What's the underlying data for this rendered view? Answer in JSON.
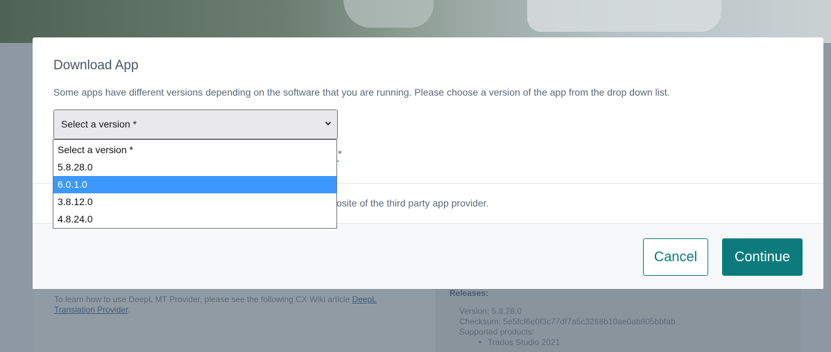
{
  "background": {
    "article_text": "To learn how to use DeepL MT Provider, please see the following CX Wiki article",
    "article_link": "DeepL Translation Provider",
    "article_link_line1": "DeepL",
    "article_link_line2": "Translation Provider",
    "article_end": ".",
    "releases_title": "Releases:",
    "version": "Version: 5.8.28.0",
    "checksum": "Checksum: 5e5fcf6e0f3c77df7a5c3268b10ae0ab905bbfab",
    "supported_products": "Supported products:",
    "product_bullet": "•",
    "product": "Trados Studio 2021"
  },
  "modal": {
    "title": "Download App",
    "description": "Some apps have different versions depending on the software that you are running. Please choose a version of the app from the drop down list.",
    "agree_asterisk": "*",
    "third_party_text": "osite of the third party app provider.",
    "cancel_label": "Cancel",
    "continue_label": "Continue"
  },
  "version_select": {
    "selected_value": "Select a version *",
    "highlighted_option": "6.0.1.0",
    "options": [
      "Select a version *",
      "5.8.28.0",
      "6.0.1.0",
      "3.8.12.0",
      "4.8.24.0"
    ]
  },
  "colors": {
    "accent": "#0b7c7b",
    "highlight": "#3c97fe"
  }
}
